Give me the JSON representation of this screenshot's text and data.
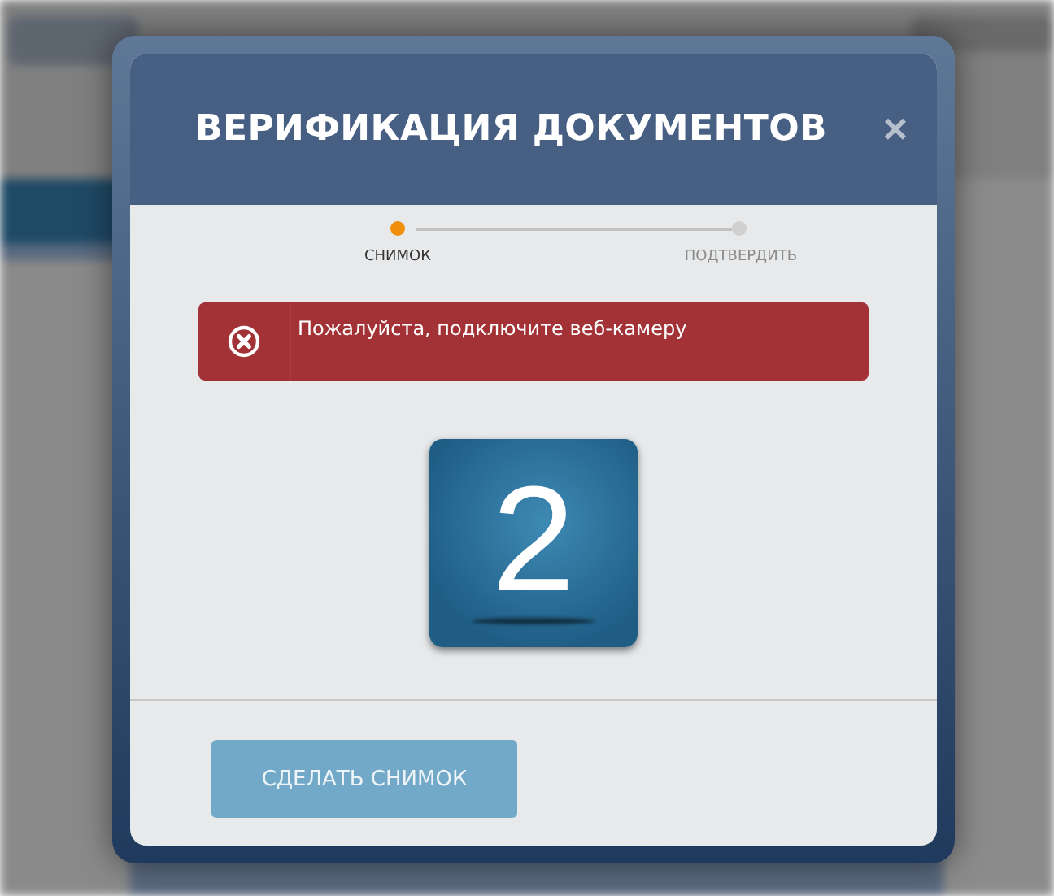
{
  "dialog": {
    "title": "ВЕРИФИКАЦИЯ ДОКУМЕНТОВ",
    "close": "×"
  },
  "steps": [
    {
      "label": "СНИМОК",
      "selected": true
    },
    {
      "label": "ПОДТВЕРДИТЬ",
      "selected": false
    }
  ],
  "alert": {
    "message": "Пожалуйста, подключите веб-камеру"
  },
  "countdown": "2",
  "button": {
    "label": "СДЕЛАТЬ СНИМОК",
    "disabled": true
  }
}
